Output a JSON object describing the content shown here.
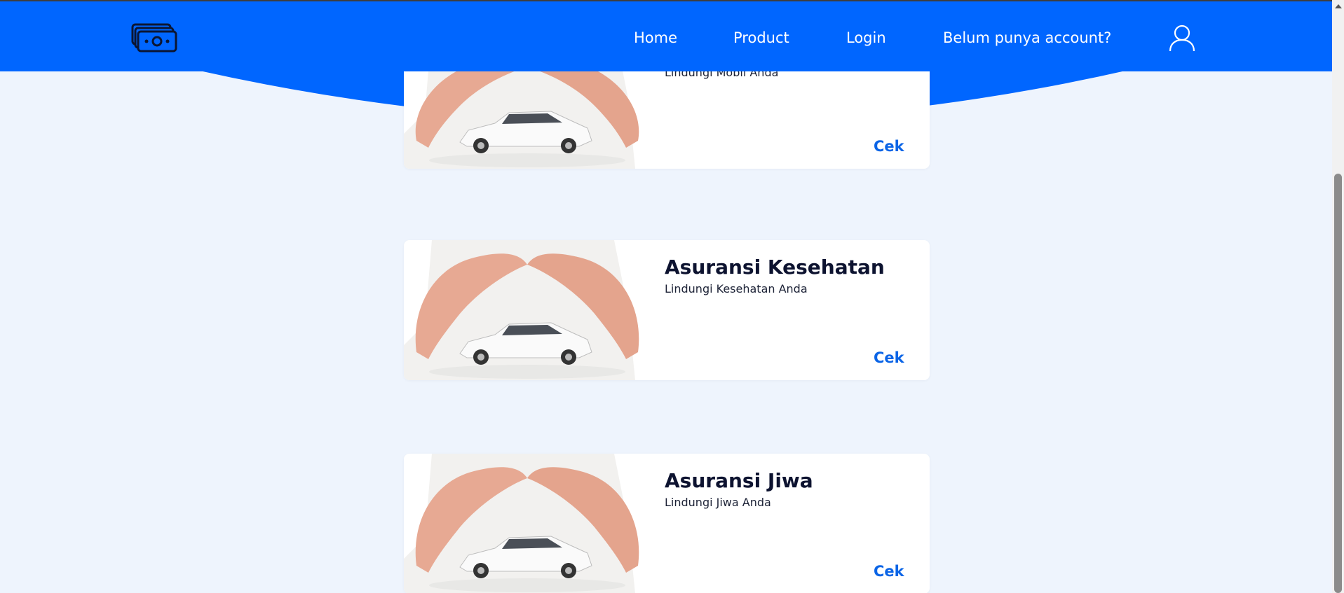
{
  "colors": {
    "brand_blue": "#0066ff",
    "page_bg": "#eef4fd",
    "card_bg": "#ffffff",
    "title_text": "#0d1330",
    "cek_link": "#0a64e6"
  },
  "navbar": {
    "logo_icon": "money-stack-icon",
    "links": {
      "home": "Home",
      "product": "Product",
      "login": "Login",
      "register": "Belum punya account?"
    },
    "user_icon": "user-icon"
  },
  "cards": [
    {
      "title": "",
      "subtitle": "Lindungi Mobil Anda",
      "action": "Cek"
    },
    {
      "title": "Asuransi Kesehatan",
      "subtitle": "Lindungi Kesehatan Anda",
      "action": "Cek"
    },
    {
      "title": "Asuransi Jiwa",
      "subtitle": "Lindungi Jiwa Anda",
      "action": "Cek"
    }
  ]
}
